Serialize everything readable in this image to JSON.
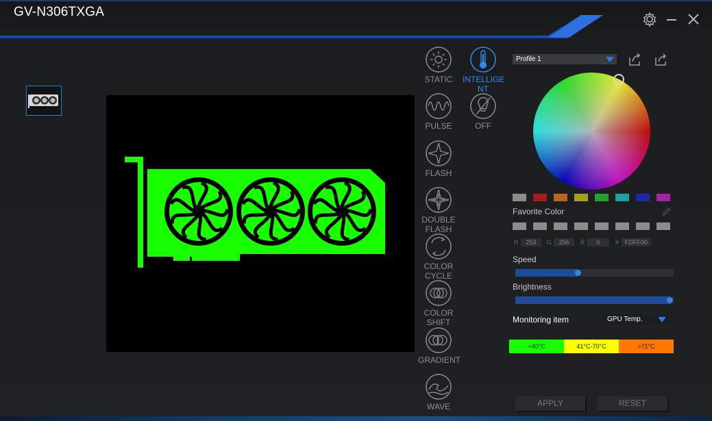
{
  "window": {
    "title": "GV-N306TXGA",
    "controls": [
      "gear-icon",
      "minimize-icon",
      "close-icon"
    ]
  },
  "modes": [
    {
      "id": "static",
      "label_lines": [
        "STATIC"
      ],
      "icon": "sun-icon",
      "active": false
    },
    {
      "id": "intelligent",
      "label_lines": [
        "INTELLIGE",
        "NT"
      ],
      "icon": "thermometer-icon",
      "active": true
    },
    {
      "id": "pulse",
      "label_lines": [
        "PULSE"
      ],
      "icon": "pulse-wave-icon",
      "active": false
    },
    {
      "id": "off",
      "label_lines": [
        "OFF"
      ],
      "icon": "bulb-off-icon",
      "active": false
    },
    {
      "id": "flash",
      "label_lines": [
        "FLASH"
      ],
      "icon": "flash-star-icon",
      "active": false
    },
    {
      "id": "double-flash",
      "label_lines": [
        "DOUBLE",
        "FLASH"
      ],
      "icon": "double-flash-icon",
      "active": false
    },
    {
      "id": "color-cycle",
      "label_lines": [
        "COLOR",
        "CYCLE"
      ],
      "icon": "cycle-arrows-icon",
      "active": false
    },
    {
      "id": "color-shift",
      "label_lines": [
        "COLOR",
        "SHIFT"
      ],
      "icon": "overlap-circles-icon",
      "active": false
    },
    {
      "id": "gradient",
      "label_lines": [
        "GRADIENT"
      ],
      "icon": "gradient-circles-icon",
      "active": false
    },
    {
      "id": "wave",
      "label_lines": [
        "WAVE"
      ],
      "icon": "wave-icon",
      "active": false
    }
  ],
  "profile": {
    "selected": "Profile 1",
    "import_icon": "import-icon",
    "export_icon": "export-icon"
  },
  "color": {
    "preset_swatches": [
      "#8c8c8c",
      "#a61d1d",
      "#b8661c",
      "#a6a01f",
      "#24a031",
      "#1fa0a0",
      "#1d2aa6",
      "#a024a6"
    ],
    "favorite_label": "Favorite Color",
    "favorite_swatches": [
      "#8c8c8c",
      "#8c8c8c",
      "#8c8c8c",
      "#8c8c8c",
      "#8c8c8c",
      "#8c8c8c",
      "#8c8c8c",
      "#8c8c8c"
    ],
    "r_label": "R",
    "r": "253",
    "g_label": "G",
    "g": "256",
    "b_label": "B",
    "b": "0",
    "hex_label": "#",
    "hex": "FDFF00"
  },
  "speed": {
    "label": "Speed",
    "level": 0.4
  },
  "brightness": {
    "label": "Brightness",
    "level": 0.98
  },
  "monitoring": {
    "label": "Monitoring item",
    "selected": "GPU Temp."
  },
  "temperature_ranges": [
    {
      "label": "<40°C",
      "color": "#18ff00"
    },
    {
      "label": "41°C-70°C",
      "color": "#ffff00"
    },
    {
      "label": ">71°C",
      "color": "#ff7800"
    }
  ],
  "preview": {
    "card_color": "#18ff00"
  },
  "buttons": {
    "apply": "APPLY",
    "reset": "RESET"
  }
}
